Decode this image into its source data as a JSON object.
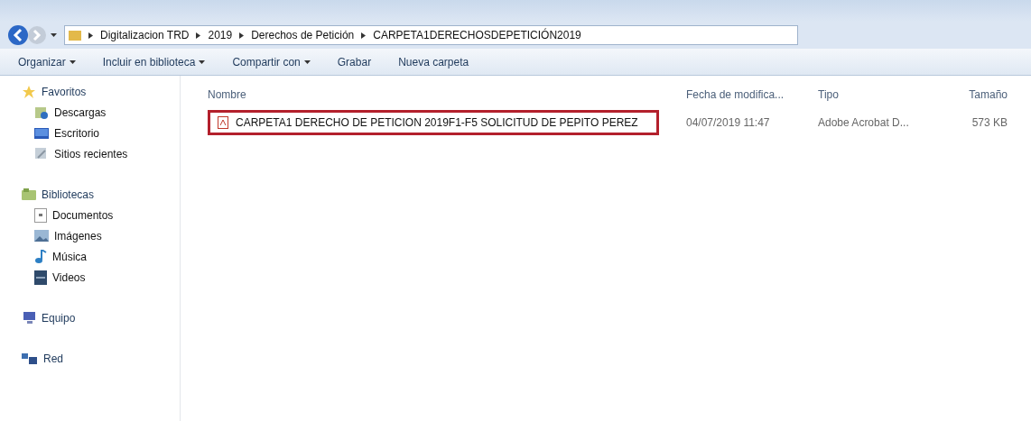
{
  "breadcrumb": [
    "Digitalizacion TRD",
    "2019",
    "Derechos de Petición",
    "CARPETA1DERECHOSDEPETICIÓN2019"
  ],
  "toolbar": [
    {
      "label": "Organizar",
      "dropdown": true
    },
    {
      "label": "Incluir en biblioteca",
      "dropdown": true
    },
    {
      "label": "Compartir con",
      "dropdown": true
    },
    {
      "label": "Grabar",
      "dropdown": false
    },
    {
      "label": "Nueva carpeta",
      "dropdown": false
    }
  ],
  "sidebar": {
    "groups": [
      {
        "label": "Favoritos",
        "children": [
          {
            "label": "Descargas"
          },
          {
            "label": "Escritorio"
          },
          {
            "label": "Sitios recientes"
          }
        ]
      },
      {
        "label": "Bibliotecas",
        "children": [
          {
            "label": "Documentos"
          },
          {
            "label": "Imágenes"
          },
          {
            "label": "Música"
          },
          {
            "label": "Videos"
          }
        ]
      },
      {
        "label": "Equipo"
      },
      {
        "label": "Red"
      }
    ]
  },
  "table": {
    "columns": [
      "Nombre",
      "Fecha de modifica...",
      "Tipo",
      "Tamaño"
    ],
    "rows": [
      {
        "name": "CARPETA1 DERECHO DE PETICION 2019F1-F5 SOLICITUD DE PEPITO PEREZ",
        "date": "04/07/2019 11:47",
        "type": "Adobe Acrobat D...",
        "size": "573 KB",
        "highlighted": true
      }
    ]
  }
}
